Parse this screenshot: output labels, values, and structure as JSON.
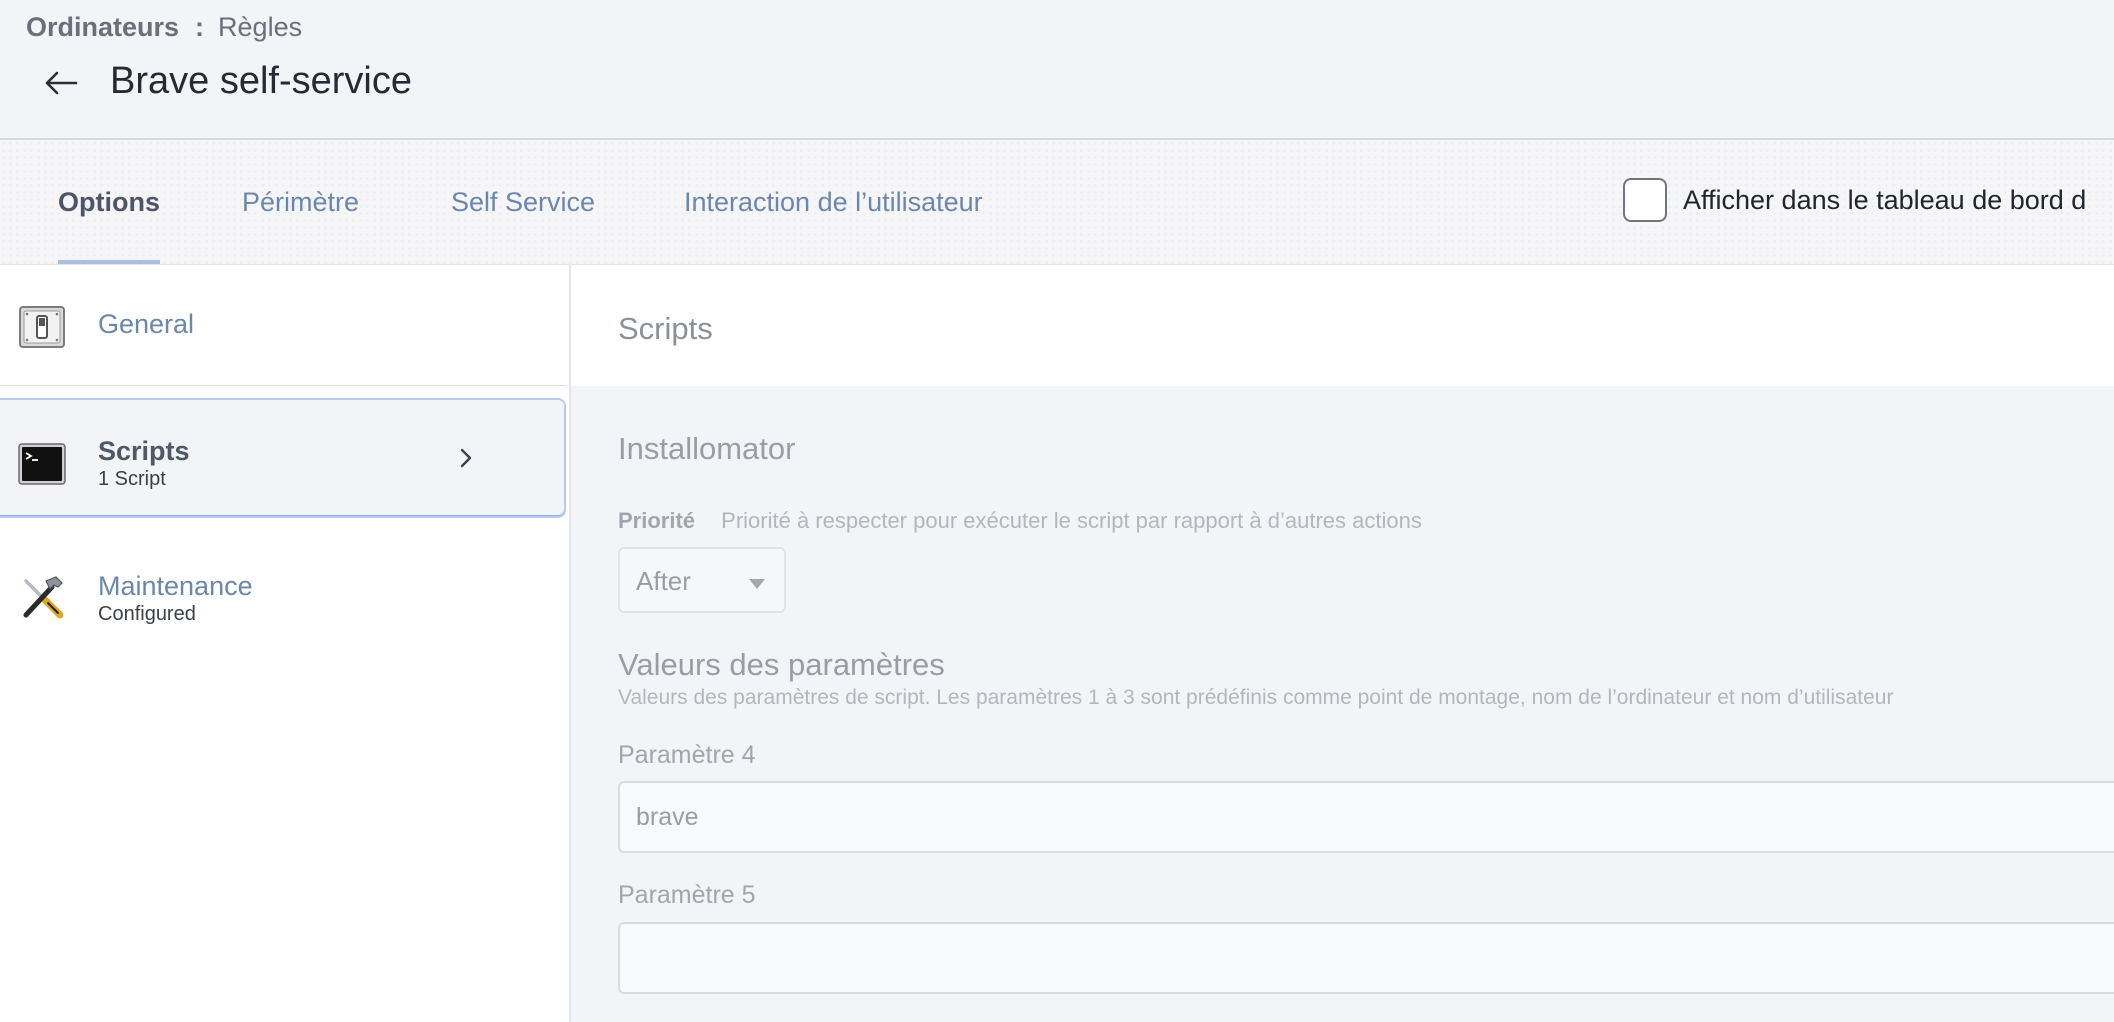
{
  "header": {
    "breadcrumb": {
      "root": "Ordinateurs",
      "separator": ":",
      "current": "Règles"
    },
    "title": "Brave self-service",
    "back_icon": "arrow-left-icon"
  },
  "tabs": [
    {
      "label": "Options",
      "active": true
    },
    {
      "label": "Périmètre",
      "active": false
    },
    {
      "label": "Self Service",
      "active": false
    },
    {
      "label": "Interaction de l’utilisateur",
      "active": false
    }
  ],
  "dashboard_checkbox": {
    "label": "Afficher dans le tableau de bord d",
    "checked": false
  },
  "sidebar": {
    "items": [
      {
        "label": "General",
        "sub": "",
        "icon": "switch-icon",
        "selected": false
      },
      {
        "label": "Scripts",
        "sub": "1 Script",
        "icon": "terminal-icon",
        "selected": true
      },
      {
        "label": "Maintenance",
        "sub": "Configured",
        "icon": "tools-icon",
        "selected": false
      }
    ]
  },
  "main": {
    "section_title": "Scripts",
    "script": {
      "name": "Installomator",
      "priority_label": "Priorité",
      "priority_desc": "Priorité à respecter pour exécuter le script par rapport à d’autres actions",
      "priority_value": "After"
    },
    "params": {
      "title": "Valeurs des paramètres",
      "desc": "Valeurs des paramètres de script. Les paramètres 1 à 3 sont prédéfinis comme point de montage, nom de l’ordinateur et nom d’utilisateur",
      "p4": {
        "label": "Paramètre 4",
        "value": "brave"
      },
      "p5": {
        "label": "Paramètre 5",
        "value": ""
      }
    }
  },
  "colors": {
    "tab_text": "#6c86ad",
    "active_underline": "#a9c0e2",
    "header_bg": "#f3f4f8",
    "selected_border": "#b8cbea"
  }
}
